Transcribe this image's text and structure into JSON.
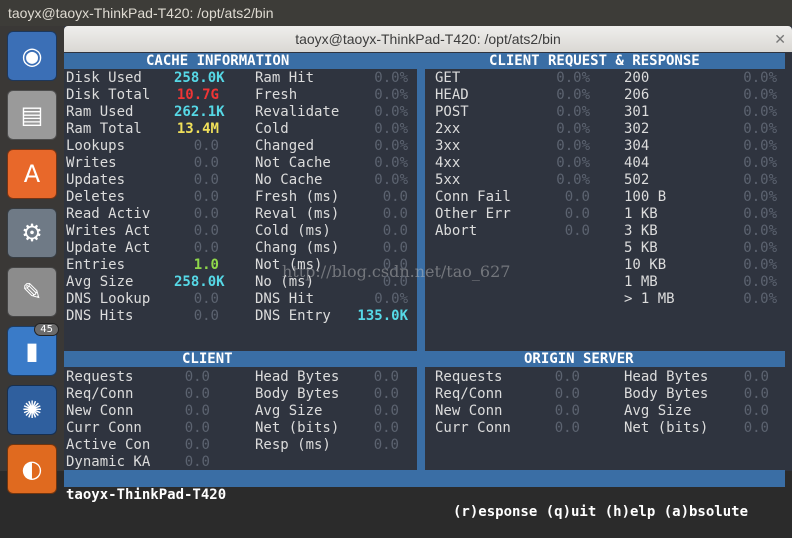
{
  "topbar": {
    "title": "taoyx@taoyx-ThinkPad-T420: /opt/ats2/bin"
  },
  "launcher": {
    "items": [
      {
        "icon": "ubuntu-logo-icon",
        "color": "#3b6fb6"
      },
      {
        "icon": "file-cabinet-icon",
        "color": "#9a9a9a"
      },
      {
        "icon": "software-center-icon",
        "color": "#e8682a"
      },
      {
        "icon": "settings-wrench-icon",
        "color": "#6f7a86"
      },
      {
        "icon": "text-editor-icon",
        "color": "#8c8c8c"
      },
      {
        "icon": "thermometer-icon",
        "color": "#3a7bc8",
        "badge": "45"
      },
      {
        "icon": "shutter-aperture-icon",
        "color": "#2f5f9e"
      },
      {
        "icon": "firefox-icon",
        "color": "#e06a1f"
      }
    ]
  },
  "window": {
    "title": "taoyx@taoyx-ThinkPad-T420: /opt/ats2/bin"
  },
  "panels": {
    "cache_title": "CACHE INFORMATION",
    "client_rr_title": "CLIENT REQUEST & RESPONSE",
    "client_title": "CLIENT",
    "origin_title": "ORIGIN SERVER"
  },
  "cache_col1": [
    {
      "label": "Disk Used",
      "value": "258.0K",
      "style": "cyan"
    },
    {
      "label": "Disk Total",
      "value": "10.7G",
      "style": "red"
    },
    {
      "label": "Ram Used",
      "value": "262.1K",
      "style": "cyan"
    },
    {
      "label": "Ram Total",
      "value": "13.4M",
      "style": "yellow"
    },
    {
      "label": "Lookups",
      "value": "0.0",
      "style": "dim"
    },
    {
      "label": "Writes",
      "value": "0.0",
      "style": "dim"
    },
    {
      "label": "Updates",
      "value": "0.0",
      "style": "dim"
    },
    {
      "label": "Deletes",
      "value": "0.0",
      "style": "dim"
    },
    {
      "label": "Read Activ",
      "value": "0.0",
      "style": "dim"
    },
    {
      "label": "Writes Act",
      "value": "0.0",
      "style": "dim"
    },
    {
      "label": "Update Act",
      "value": "0.0",
      "style": "dim"
    },
    {
      "label": "Entries",
      "value": "1.0",
      "style": "green"
    },
    {
      "label": "Avg Size",
      "value": "258.0K",
      "style": "cyan"
    },
    {
      "label": "DNS Lookup",
      "value": "0.0",
      "style": "dim"
    },
    {
      "label": "DNS Hits",
      "value": "0.0",
      "style": "dim"
    }
  ],
  "cache_col2": [
    {
      "label": "Ram Hit",
      "value": "0.0%",
      "style": "dim"
    },
    {
      "label": "Fresh",
      "value": "0.0%",
      "style": "dim"
    },
    {
      "label": "Revalidate",
      "value": "0.0%",
      "style": "dim"
    },
    {
      "label": "Cold",
      "value": "0.0%",
      "style": "dim"
    },
    {
      "label": "Changed",
      "value": "0.0%",
      "style": "dim"
    },
    {
      "label": "Not Cache",
      "value": "0.0%",
      "style": "dim"
    },
    {
      "label": "No Cache",
      "value": "0.0%",
      "style": "dim"
    },
    {
      "label": "Fresh (ms)",
      "value": "0.0",
      "style": "dim"
    },
    {
      "label": "Reval (ms)",
      "value": "0.0",
      "style": "dim"
    },
    {
      "label": "Cold (ms)",
      "value": "0.0",
      "style": "dim"
    },
    {
      "label": "Chang (ms)",
      "value": "0.0",
      "style": "dim"
    },
    {
      "label": "Not (ms)",
      "value": "0.0",
      "style": "dim"
    },
    {
      "label": "No (ms)",
      "value": "0.0",
      "style": "dim"
    },
    {
      "label": "DNS Hit",
      "value": "0.0%",
      "style": "dim"
    },
    {
      "label": "DNS Entry",
      "value": "135.0K",
      "style": "cyan"
    }
  ],
  "crr_col1": [
    {
      "label": "GET",
      "value": "0.0%"
    },
    {
      "label": "HEAD",
      "value": "0.0%"
    },
    {
      "label": "POST",
      "value": "0.0%"
    },
    {
      "label": "2xx",
      "value": "0.0%"
    },
    {
      "label": "3xx",
      "value": "0.0%"
    },
    {
      "label": "4xx",
      "value": "0.0%"
    },
    {
      "label": "5xx",
      "value": "0.0%"
    },
    {
      "label": "Conn Fail",
      "value": "0.0"
    },
    {
      "label": "Other Err",
      "value": "0.0"
    },
    {
      "label": "Abort",
      "value": "0.0"
    }
  ],
  "crr_col2": [
    {
      "label": "200",
      "value": "0.0%"
    },
    {
      "label": "206",
      "value": "0.0%"
    },
    {
      "label": "301",
      "value": "0.0%"
    },
    {
      "label": "302",
      "value": "0.0%"
    },
    {
      "label": "304",
      "value": "0.0%"
    },
    {
      "label": "404",
      "value": "0.0%"
    },
    {
      "label": "502",
      "value": "0.0%"
    },
    {
      "label": "100 B",
      "value": "0.0%"
    },
    {
      "label": "1 KB",
      "value": "0.0%"
    },
    {
      "label": "3 KB",
      "value": "0.0%"
    },
    {
      "label": "5 KB",
      "value": "0.0%"
    },
    {
      "label": "10 KB",
      "value": "0.0%"
    },
    {
      "label": "1 MB",
      "value": "0.0%"
    },
    {
      "label": "> 1 MB",
      "value": "0.0%"
    }
  ],
  "client_col1": [
    {
      "label": "Requests",
      "value": "0.0"
    },
    {
      "label": "Req/Conn",
      "value": "0.0"
    },
    {
      "label": "New Conn",
      "value": "0.0"
    },
    {
      "label": "Curr Conn",
      "value": "0.0"
    },
    {
      "label": "Active Con",
      "value": "0.0"
    },
    {
      "label": "Dynamic KA",
      "value": "0.0"
    }
  ],
  "client_col2": [
    {
      "label": "Head Bytes",
      "value": "0.0"
    },
    {
      "label": "Body Bytes",
      "value": "0.0"
    },
    {
      "label": "Avg Size",
      "value": "0.0"
    },
    {
      "label": "Net (bits)",
      "value": "0.0"
    },
    {
      "label": "Resp (ms)",
      "value": "0.0"
    }
  ],
  "origin_col1": [
    {
      "label": "Requests",
      "value": "0.0"
    },
    {
      "label": "Req/Conn",
      "value": "0.0"
    },
    {
      "label": "New Conn",
      "value": "0.0"
    },
    {
      "label": "Curr Conn",
      "value": "0.0"
    }
  ],
  "origin_col2": [
    {
      "label": "Head Bytes",
      "value": "0.0"
    },
    {
      "label": "Body Bytes",
      "value": "0.0"
    },
    {
      "label": "Avg Size",
      "value": "0.0"
    },
    {
      "label": "Net (bits)",
      "value": "0.0"
    }
  ],
  "status": {
    "host": "taoyx-ThinkPad-T420",
    "help": "(r)esponse (q)uit (h)elp (a)bsolute"
  },
  "watermark": "http://blog.csdn.net/tao_627"
}
